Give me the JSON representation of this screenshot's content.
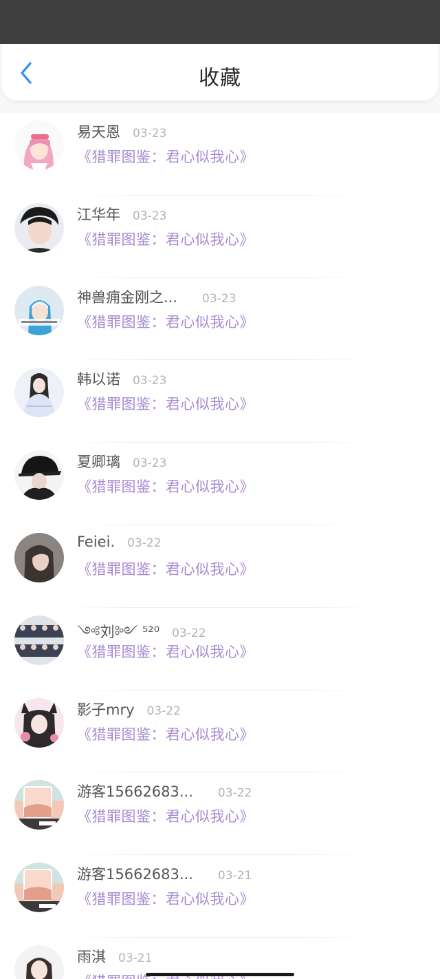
{
  "header": {
    "title": "收藏",
    "back_icon": "chevron-left-icon",
    "accent": "#2f8ef0"
  },
  "list": [
    {
      "name": "易天恩",
      "time": "03-23",
      "book": "《猎罪图鉴：君心似我心》"
    },
    {
      "name": "江华年",
      "time": "03-23",
      "book": "《猎罪图鉴：君心似我心》"
    },
    {
      "name": "神兽痈金刚之...",
      "time": "03-23",
      "book": "《猎罪图鉴：君心似我心》"
    },
    {
      "name": "韩以诺",
      "time": "03-23",
      "book": "《猎罪图鉴：君心似我心》"
    },
    {
      "name": "夏卿璃",
      "time": "03-23",
      "book": "《猎罪图鉴：君心似我心》"
    },
    {
      "name": "Feiei.",
      "time": "03-22",
      "book": "《猎罪图鉴：君心似我心》"
    },
    {
      "name": "༺刘༻ ⁵²⁰",
      "time": "03-22",
      "book": "《猎罪图鉴：君心似我心》"
    },
    {
      "name": "影子mry",
      "time": "03-22",
      "book": "《猎罪图鉴：君心似我心》"
    },
    {
      "name": "游客15662683...",
      "time": "03-22",
      "book": "《猎罪图鉴：君心似我心》"
    },
    {
      "name": "游客15662683...",
      "time": "03-21",
      "book": "《猎罪图鉴：君心似我心》"
    },
    {
      "name": "雨淇",
      "time": "03-21",
      "book": "《猎罪图鉴：君心似我心》"
    }
  ],
  "colors": {
    "book_title": "#a88ad1",
    "name": "#555555",
    "time": "#b3b3b3"
  }
}
